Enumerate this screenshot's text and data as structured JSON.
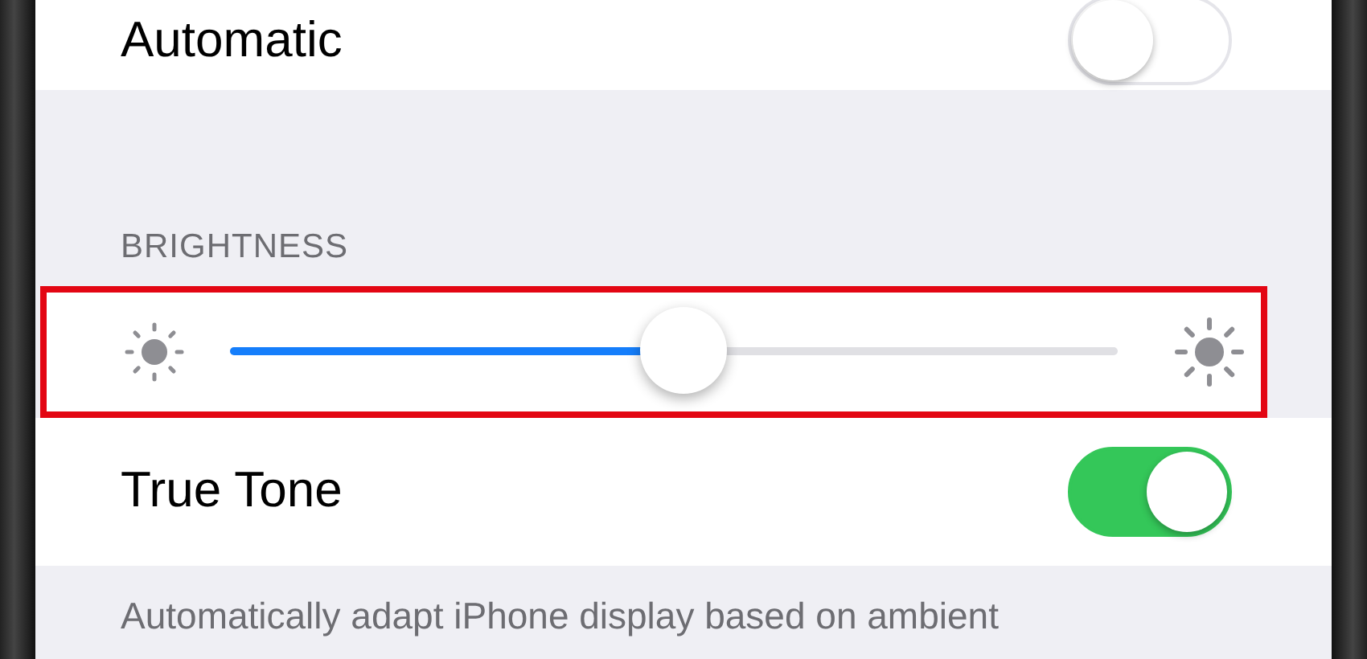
{
  "rows_top": [
    {
      "label": "Automatic",
      "on": false
    }
  ],
  "brightness": {
    "header": "BRIGHTNESS",
    "level": 0.51,
    "highlighted": true
  },
  "rows_bottom": [
    {
      "label": "True Tone",
      "on": true
    }
  ],
  "footer": "Automatically adapt iPhone display based on ambient"
}
